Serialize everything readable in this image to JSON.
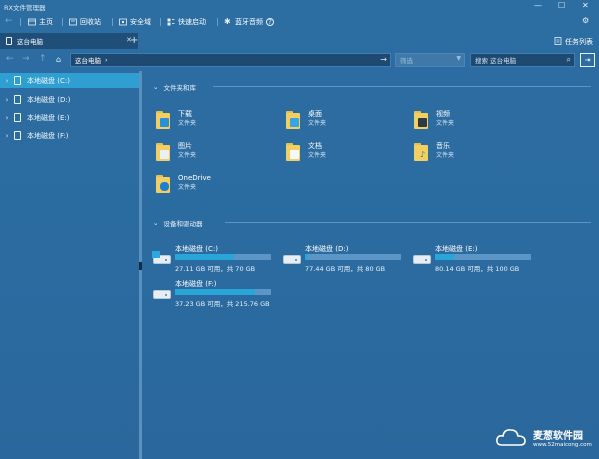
{
  "window": {
    "title": "RX文件管理器"
  },
  "toolbar": {
    "home": "主页",
    "recycle": "回收站",
    "safebox": "安全域",
    "quickstart": "快速启动",
    "bluetooth": "蓝牙音频"
  },
  "tabs": {
    "active_label": "这台电脑",
    "task_list": "任务列表"
  },
  "nav": {
    "address": "这台电脑",
    "address_chevron": "›",
    "filter_value": "筛选",
    "search_placeholder": "搜索 这台电脑"
  },
  "sidebar": {
    "items": [
      {
        "label": "本地磁盘 (C:)"
      },
      {
        "label": "本地磁盘 (D:)"
      },
      {
        "label": "本地磁盘 (E:)"
      },
      {
        "label": "本地磁盘 (F:)"
      }
    ]
  },
  "sections": {
    "folders_title": "文件夹和库",
    "drives_title": "设备和驱动器"
  },
  "folders": [
    {
      "name": "下载",
      "type": "文件夹",
      "badge": "download-arrow"
    },
    {
      "name": "桌面",
      "type": "文件夹",
      "badge": "desktop"
    },
    {
      "name": "视频",
      "type": "文件夹",
      "badge": "film"
    },
    {
      "name": "图片",
      "type": "文件夹",
      "badge": "picture"
    },
    {
      "name": "文档",
      "type": "文件夹",
      "badge": "document"
    },
    {
      "name": "音乐",
      "type": "文件夹",
      "badge": "music-note"
    },
    {
      "name": "OneDrive",
      "type": "文件夹",
      "badge": "cloud"
    }
  ],
  "drives": [
    {
      "name": "本地磁盘 (C:)",
      "info": "27.11 GB 可用，共 70 GB",
      "used_fraction": 0.61
    },
    {
      "name": "本地磁盘 (D:)",
      "info": "77.44 GB 可用，共 80 GB",
      "used_fraction": 0.03
    },
    {
      "name": "本地磁盘 (E:)",
      "info": "80.14 GB 可用，共 100 GB",
      "used_fraction": 0.2
    },
    {
      "name": "本地磁盘 (F:)",
      "info": "37.23 GB 可用，共 215.76 GB",
      "used_fraction": 0.83
    }
  ],
  "watermark": {
    "brand": "麦葱软件园",
    "url": "www.52maicong.com"
  },
  "colors": {
    "background": "#2c6da2",
    "selection": "#2e9fd0",
    "drive_bar_fill": "#2aa5d8",
    "folder": "#f1cf63"
  }
}
